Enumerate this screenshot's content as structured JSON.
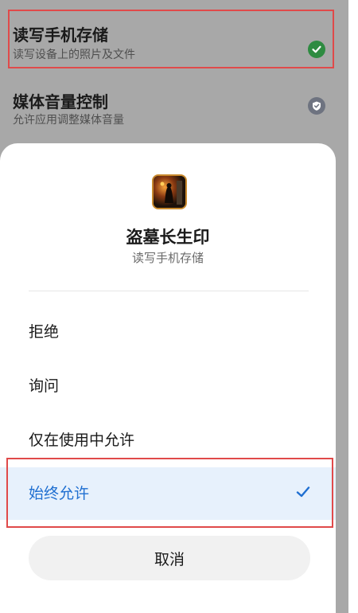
{
  "background": {
    "permissions": [
      {
        "title": "读写手机存储",
        "subtitle": "读写设备上的照片及文件",
        "status_icon": "check-circle-icon",
        "status_color": "#2e8b41"
      },
      {
        "title": "媒体音量控制",
        "subtitle": "允许应用调整媒体音量",
        "status_icon": "shield-check-icon",
        "status_color": "#6e7380"
      }
    ]
  },
  "dialog": {
    "app_icon": "game-app-icon",
    "app_name": "盗墓长生印",
    "permission_name": "读写手机存储",
    "options": [
      {
        "label": "拒绝",
        "selected": false
      },
      {
        "label": "询问",
        "selected": false
      },
      {
        "label": "仅在使用中允许",
        "selected": false
      },
      {
        "label": "始终允许",
        "selected": true
      }
    ],
    "selected_icon": "checkmark-icon",
    "cancel_label": "取消"
  },
  "colors": {
    "highlight_border": "#e04a4a",
    "selected_accent": "#1f6fd1",
    "selected_bg": "#e7f1fc",
    "dim_overlay": "#a8a8a8"
  }
}
